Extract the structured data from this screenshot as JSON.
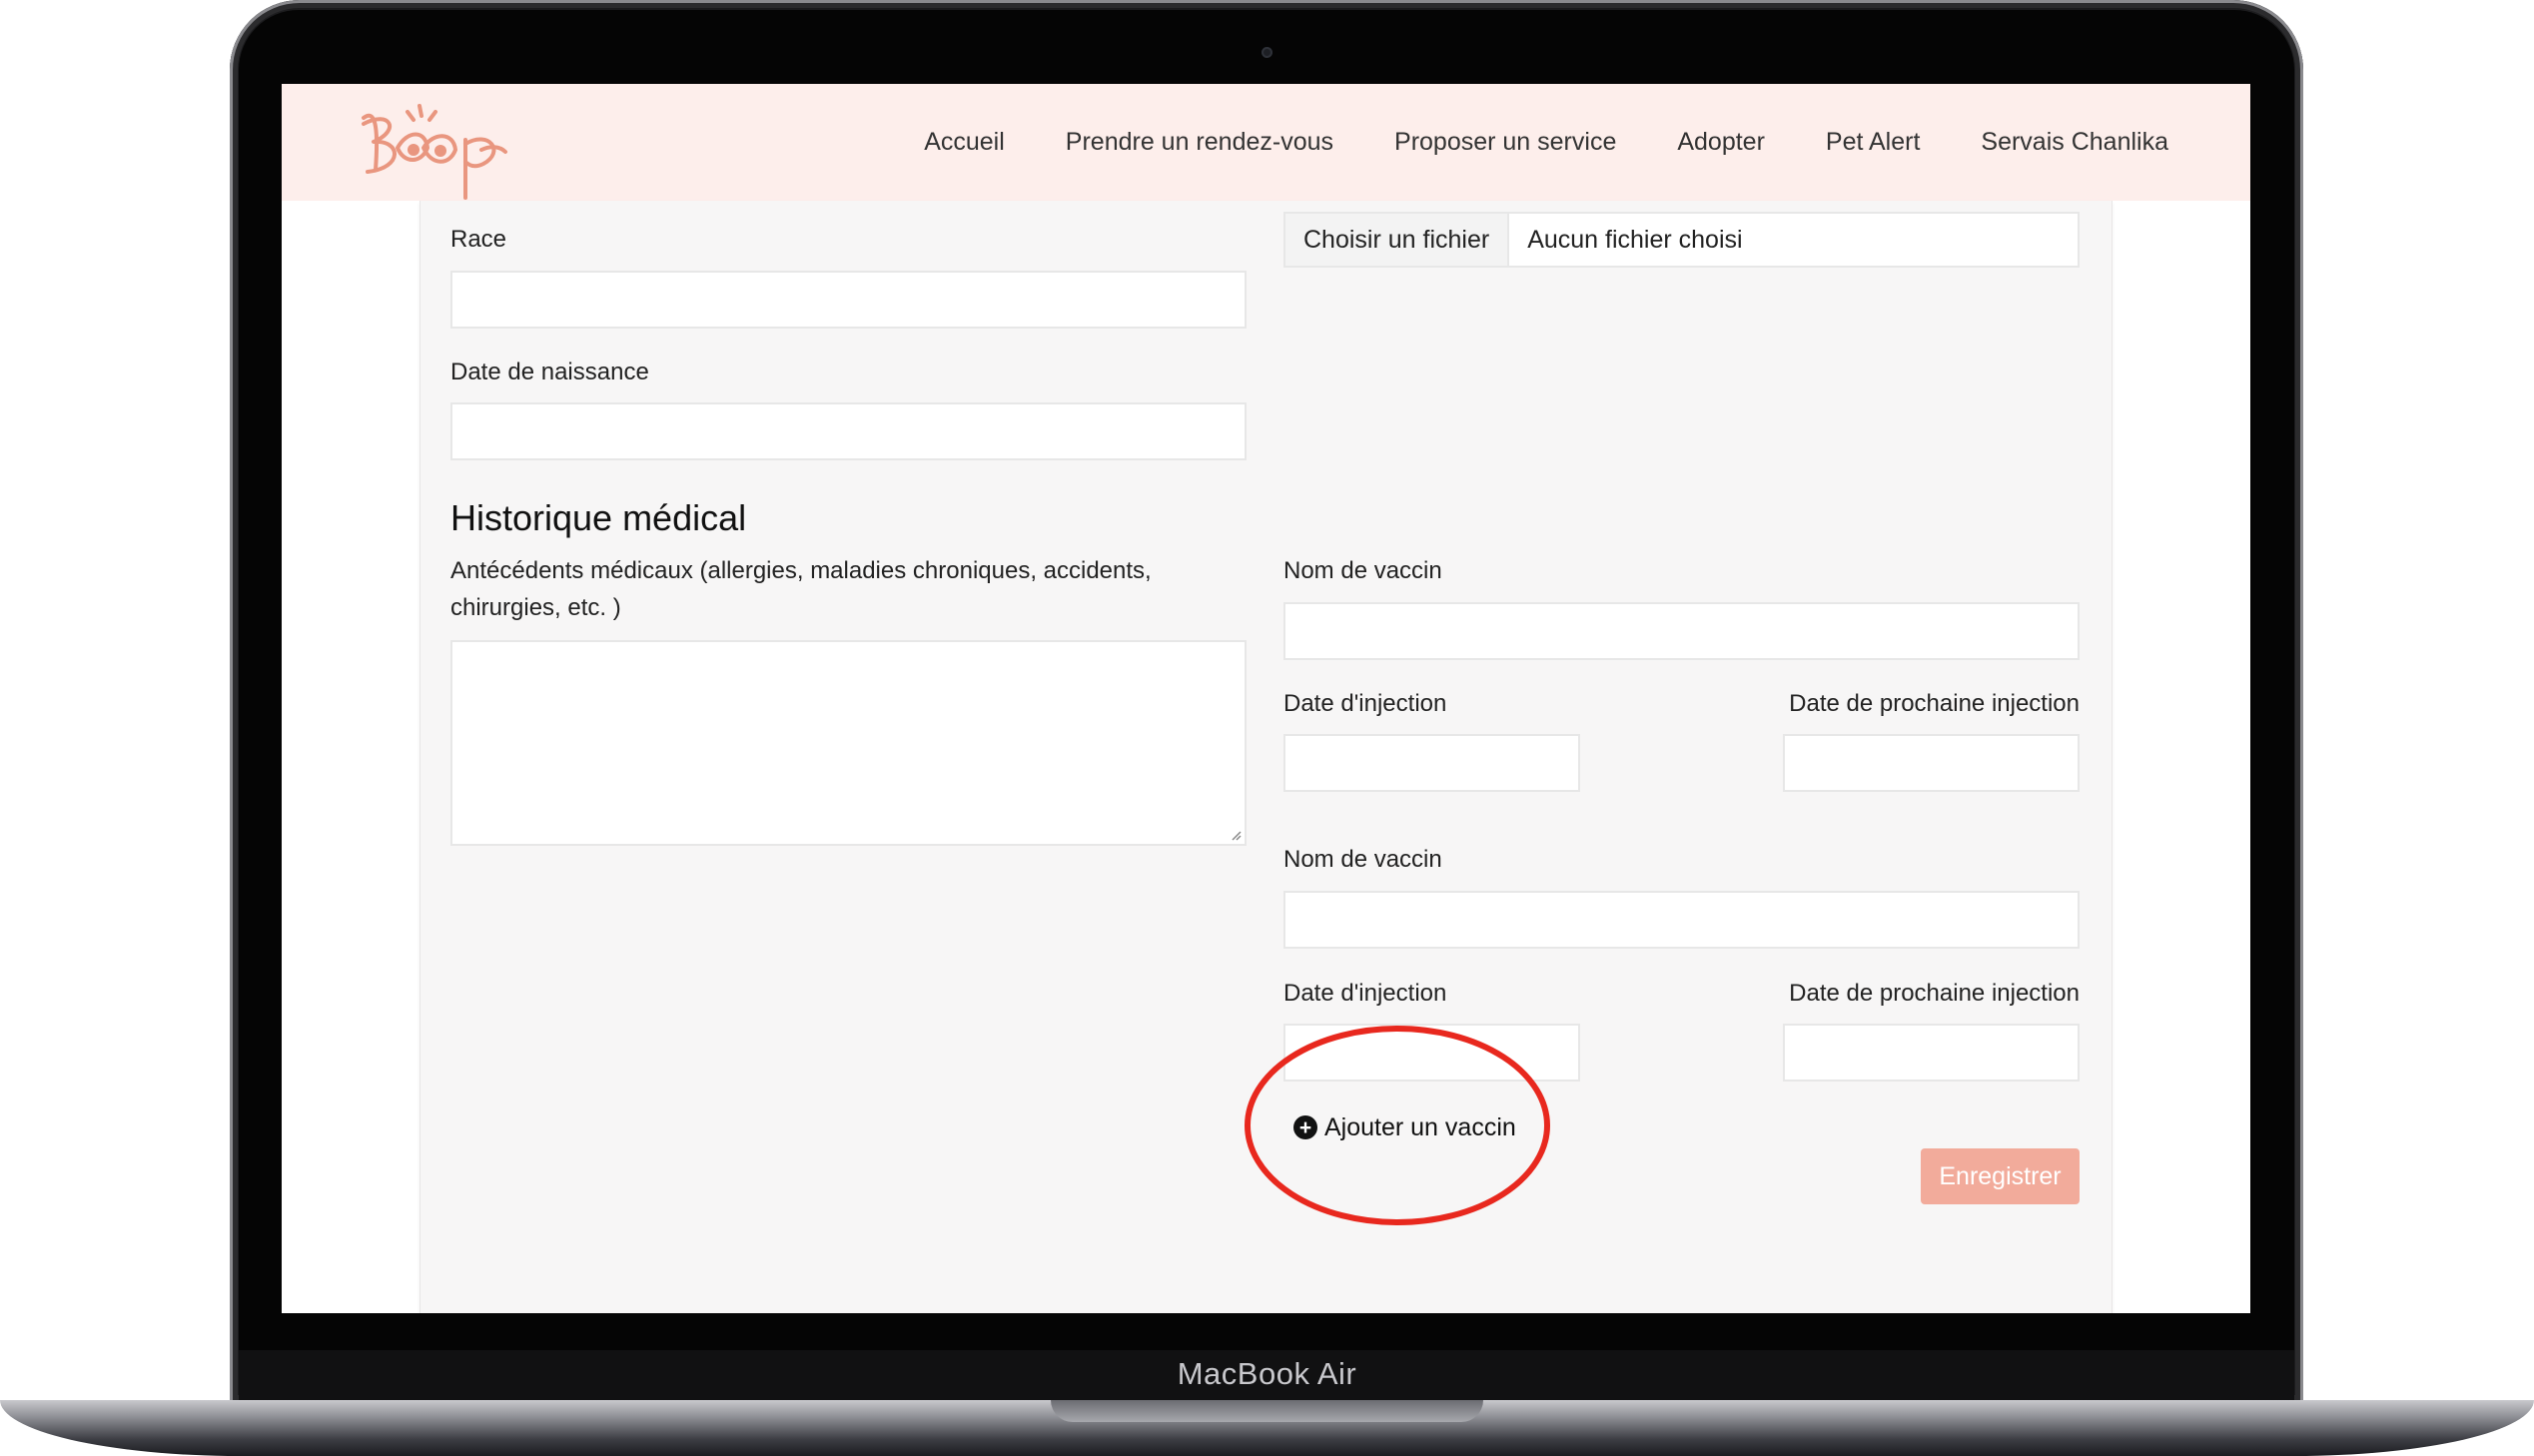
{
  "device": {
    "label": "MacBook Air"
  },
  "nav": {
    "links": [
      "Accueil",
      "Prendre un rendez-vous",
      "Proposer un service",
      "Adopter",
      "Pet Alert",
      "Servais Chanlika"
    ]
  },
  "form": {
    "race_label": "Race",
    "birthdate_label": "Date de naissance",
    "file_button": "Choisir un fichier",
    "file_status": "Aucun fichier choisi",
    "medical_heading": "Historique médical",
    "history_label_line1": "Antécédents médicaux (allergies, maladies chroniques, accidents,",
    "history_label_line2": "chirurgies, etc. )",
    "vaccines": [
      {
        "name_label": "Nom de vaccin",
        "injection_label": "Date d'injection",
        "next_label": "Date de prochaine injection"
      },
      {
        "name_label": "Nom de vaccin",
        "injection_label": "Date d'injection",
        "next_label": "Date de prochaine injection"
      }
    ],
    "add_vaccine": "Ajouter un vaccin",
    "save": "Enregistrer"
  },
  "colors": {
    "navbar_bg": "#fdeeeb",
    "brand": "#e9967f",
    "save_button": "#f2ab9b",
    "annotation": "#e8281e"
  },
  "icons": {
    "add": "plus-circle-icon",
    "logo": "boop-logo"
  }
}
